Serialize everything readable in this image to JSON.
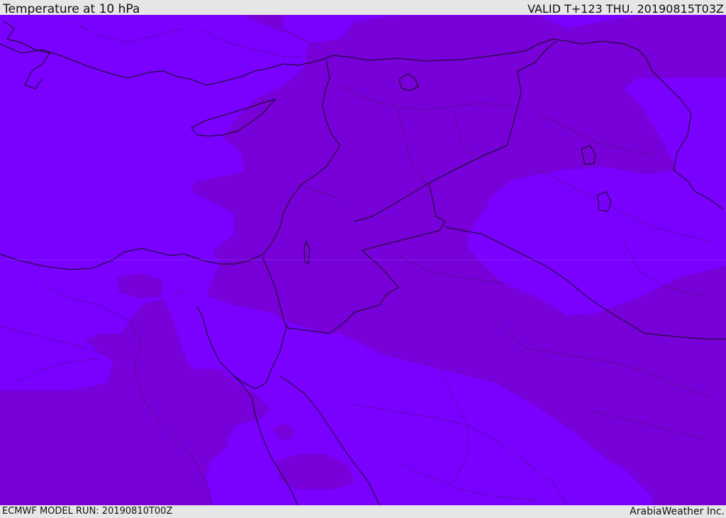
{
  "header": {
    "title": "Temperature at 10 hPa",
    "valid_time": "VALID T+123 THU. 20190815T03Z"
  },
  "footer": {
    "model_run": "ECMWF MODEL RUN: 20190810T00Z",
    "credit": "ArabiaWeather Inc."
  },
  "map": {
    "region": "Eastern Mediterranean / Middle East",
    "colors": {
      "field_light": "#7a00ff",
      "field_dark": "#7800d8",
      "coastline": "#111111",
      "border": "#111111"
    }
  }
}
